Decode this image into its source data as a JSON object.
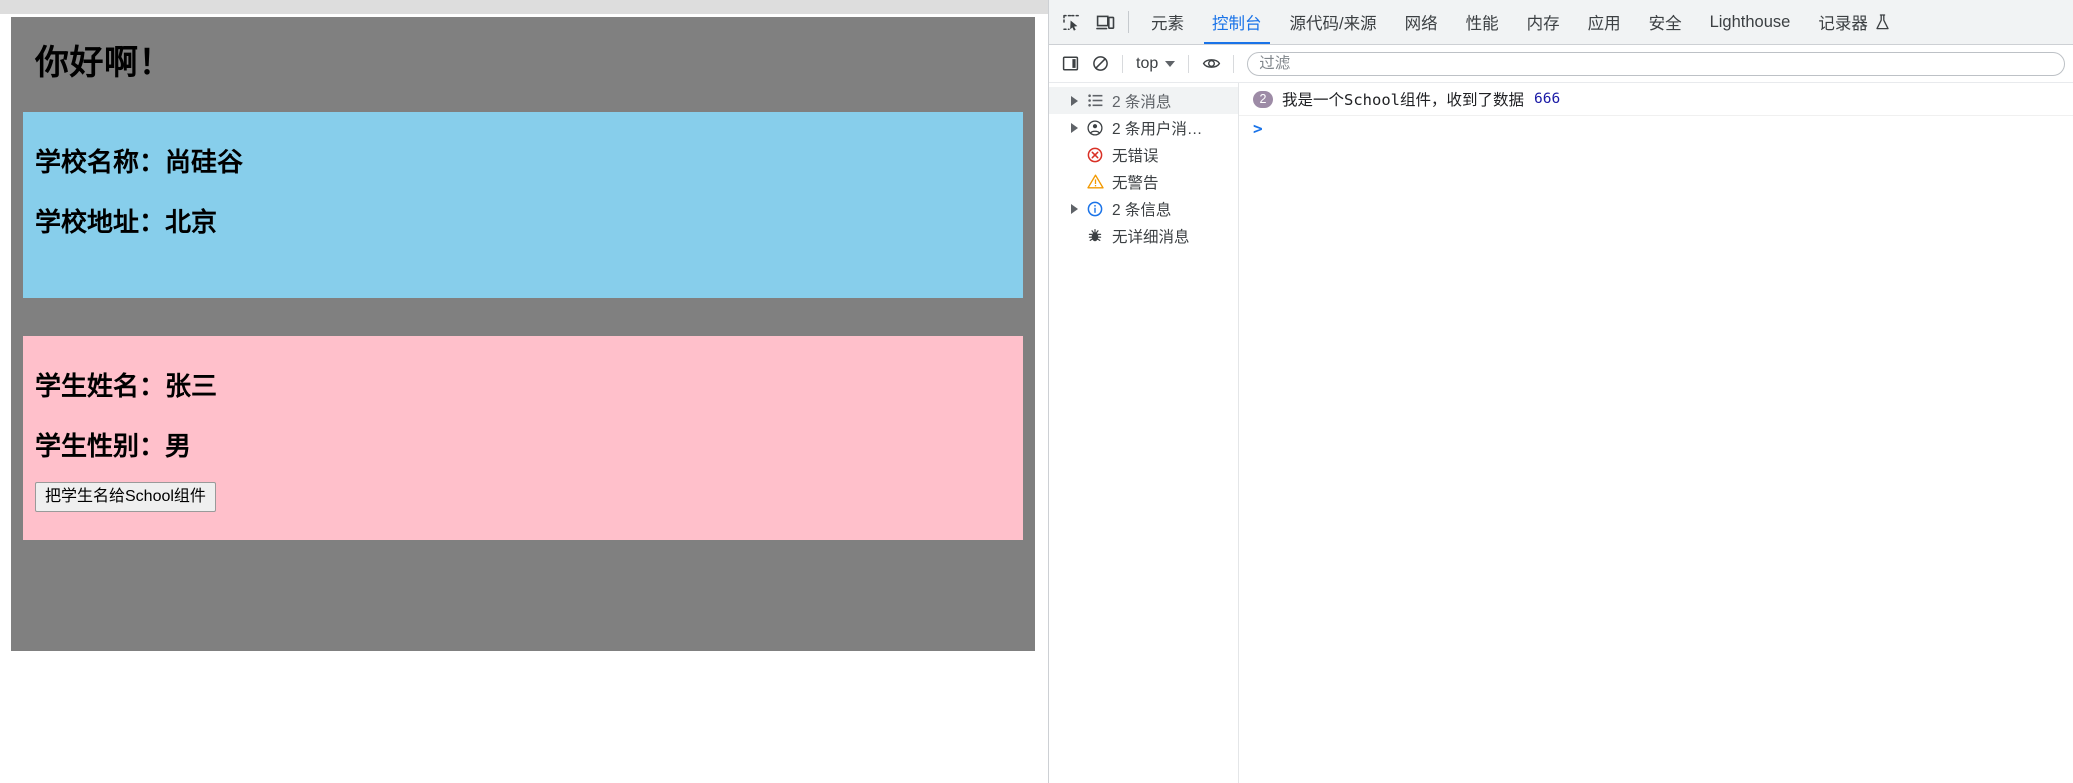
{
  "page": {
    "greeting": "你好啊！",
    "school": {
      "name_line": "学校名称：尚硅谷",
      "address_line": "学校地址：北京",
      "bg_color": "#87ceeb"
    },
    "student": {
      "name_line": "学生姓名：张三",
      "gender_line": "学生性别：男",
      "button_label": "把学生名给School组件",
      "bg_color": "#ffc0cb"
    },
    "container_bg": "#808080"
  },
  "devtools": {
    "tabbar": {
      "inspect_icon": "inspect-element-icon",
      "device_icon": "device-toolbar-icon",
      "tabs": [
        {
          "label": "元素",
          "active": false
        },
        {
          "label": "控制台",
          "active": true
        },
        {
          "label": "源代码/来源",
          "active": false
        },
        {
          "label": "网络",
          "active": false
        },
        {
          "label": "性能",
          "active": false
        },
        {
          "label": "内存",
          "active": false
        },
        {
          "label": "应用",
          "active": false
        },
        {
          "label": "安全",
          "active": false
        },
        {
          "label": "Lighthouse",
          "active": false
        },
        {
          "label": "记录器",
          "active": false,
          "flask": true
        }
      ],
      "active_color": "#1a73e8"
    },
    "toolbar": {
      "sidebar_toggle_icon": "console-sidebar-toggle-icon",
      "clear_icon": "clear-console-icon",
      "context_label": "top",
      "eye_icon": "live-expression-icon",
      "filter_placeholder": "过滤",
      "filter_value": ""
    },
    "sidebar": [
      {
        "label": "2 条消息",
        "icon": "list-icon",
        "expandable": true,
        "selected": true,
        "muted": true
      },
      {
        "label": "2 条用户消…",
        "icon": "user-message-icon",
        "expandable": true,
        "selected": false,
        "muted": false
      },
      {
        "label": "无错误",
        "icon": "error-icon",
        "expandable": false,
        "selected": false,
        "muted": false
      },
      {
        "label": "无警告",
        "icon": "warning-icon",
        "expandable": false,
        "selected": false,
        "muted": false
      },
      {
        "label": "2 条信息",
        "icon": "info-icon",
        "expandable": true,
        "selected": false,
        "muted": false
      },
      {
        "label": "无详细消息",
        "icon": "verbose-bug-icon",
        "expandable": false,
        "selected": false,
        "muted": false
      }
    ],
    "console": {
      "messages": [
        {
          "count": "2",
          "text": "我是一个School组件，收到了数据",
          "value": "666"
        }
      ],
      "prompt": ">"
    }
  }
}
